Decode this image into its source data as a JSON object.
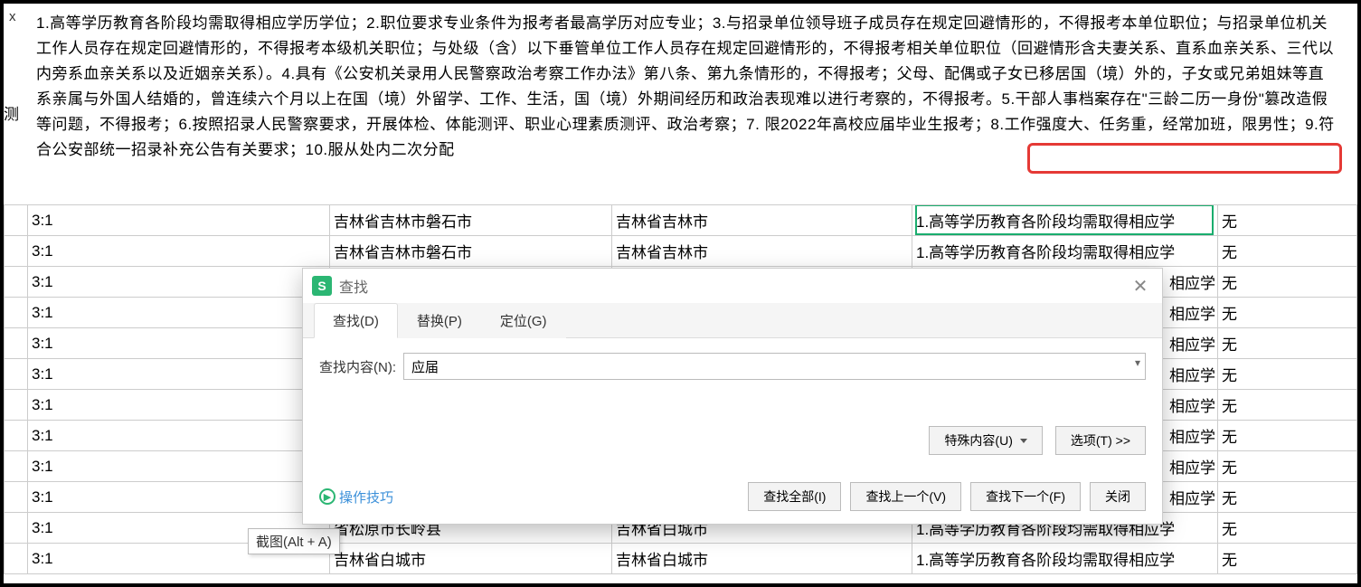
{
  "formula_x": "x",
  "left_col_label": "测",
  "big_text": "1.高等学历教育各阶段均需取得相应学历学位；2.职位要求专业条件为报考者最高学历对应专业；3.与招录单位领导班子成员存在规定回避情形的，不得报考本单位职位；与招录单位机关工作人员存在规定回避情形的，不得报考本级机关职位；与处级（含）以下垂管单位工作人员存在规定回避情形的，不得报考相关单位职位（回避情形含夫妻关系、直系血亲关系、三代以内旁系血亲关系以及近姻亲关系）。4.具有《公安机关录用人民警察政治考察工作办法》第八条、第九条情形的，不得报考；父母、配偶或子女已移居国（境）外的，子女或兄弟姐妹等直系亲属与外国人结婚的，曾连续六个月以上在国（境）外留学、工作、生活，国（境）外期间经历和政治表现难以进行考察的，不得报考。5.干部人事档案存在\"三龄二历一身份\"篡改造假等问题，不得报考；6.按照招录人民警察要求，开展体检、体能测评、职业心理素质测评、政治考察；7. 限2022年高校应届毕业生报考；8.工作强度大、任务重，经常加班，限男性；9.符合公安部统一招录补充公告有关要求；10.服从处内二次分配",
  "tooltip": "截图(Alt + A)",
  "rows": [
    {
      "c1": "",
      "c2": "3:1",
      "c3": "吉林省吉林市磐石市",
      "c4": "吉林省吉林市",
      "c5": "1.高等学历教育各阶段均需取得相应学",
      "c6": "无"
    },
    {
      "c1": "",
      "c2": "3:1",
      "c3": "吉林省吉林市磐石市",
      "c4": "吉林省吉林市",
      "c5": "1.高等学历教育各阶段均需取得相应学",
      "c6": "无"
    },
    {
      "c1": "",
      "c2": "3:1",
      "c3": "",
      "c4": "",
      "c5": "相应学",
      "c6": "无"
    },
    {
      "c1": "",
      "c2": "3:1",
      "c3": "",
      "c4": "",
      "c5": "相应学",
      "c6": "无"
    },
    {
      "c1": "",
      "c2": "3:1",
      "c3": "",
      "c4": "",
      "c5": "相应学",
      "c6": "无"
    },
    {
      "c1": "",
      "c2": "3:1",
      "c3": "",
      "c4": "",
      "c5": "相应学",
      "c6": "无"
    },
    {
      "c1": "",
      "c2": "3:1",
      "c3": "",
      "c4": "",
      "c5": "相应学",
      "c6": "无"
    },
    {
      "c1": "",
      "c2": "3:1",
      "c3": "",
      "c4": "",
      "c5": "相应学",
      "c6": "无"
    },
    {
      "c1": "",
      "c2": "3:1",
      "c3": "",
      "c4": "",
      "c5": "相应学",
      "c6": "无"
    },
    {
      "c1": "",
      "c2": "3:1",
      "c3": "",
      "c4": "",
      "c5": "相应学",
      "c6": "无"
    },
    {
      "c1": "",
      "c2": "3:1",
      "c3": "省松原市长岭县",
      "c4": "吉林省白城市",
      "c5": "1.高等学历教育各阶段均需取得相应学",
      "c6": "无"
    },
    {
      "c1": "",
      "c2": "3:1",
      "c3": "吉林省白城市",
      "c4": "吉林省白城市",
      "c5": "1.高等学历教育各阶段均需取得相应学",
      "c6": "无"
    }
  ],
  "dialog": {
    "title": "查找",
    "logo": "S",
    "tabs": {
      "find": "查找(D)",
      "replace": "替换(P)",
      "goto": "定位(G)"
    },
    "find_label": "查找内容(N):",
    "find_value": "应届",
    "special_btn": "特殊内容(U)",
    "options_btn": "选项(T) >>",
    "tips": "操作技巧",
    "btn_all": "查找全部(I)",
    "btn_prev": "查找上一个(V)",
    "btn_next": "查找下一个(F)",
    "btn_close": "关闭"
  }
}
